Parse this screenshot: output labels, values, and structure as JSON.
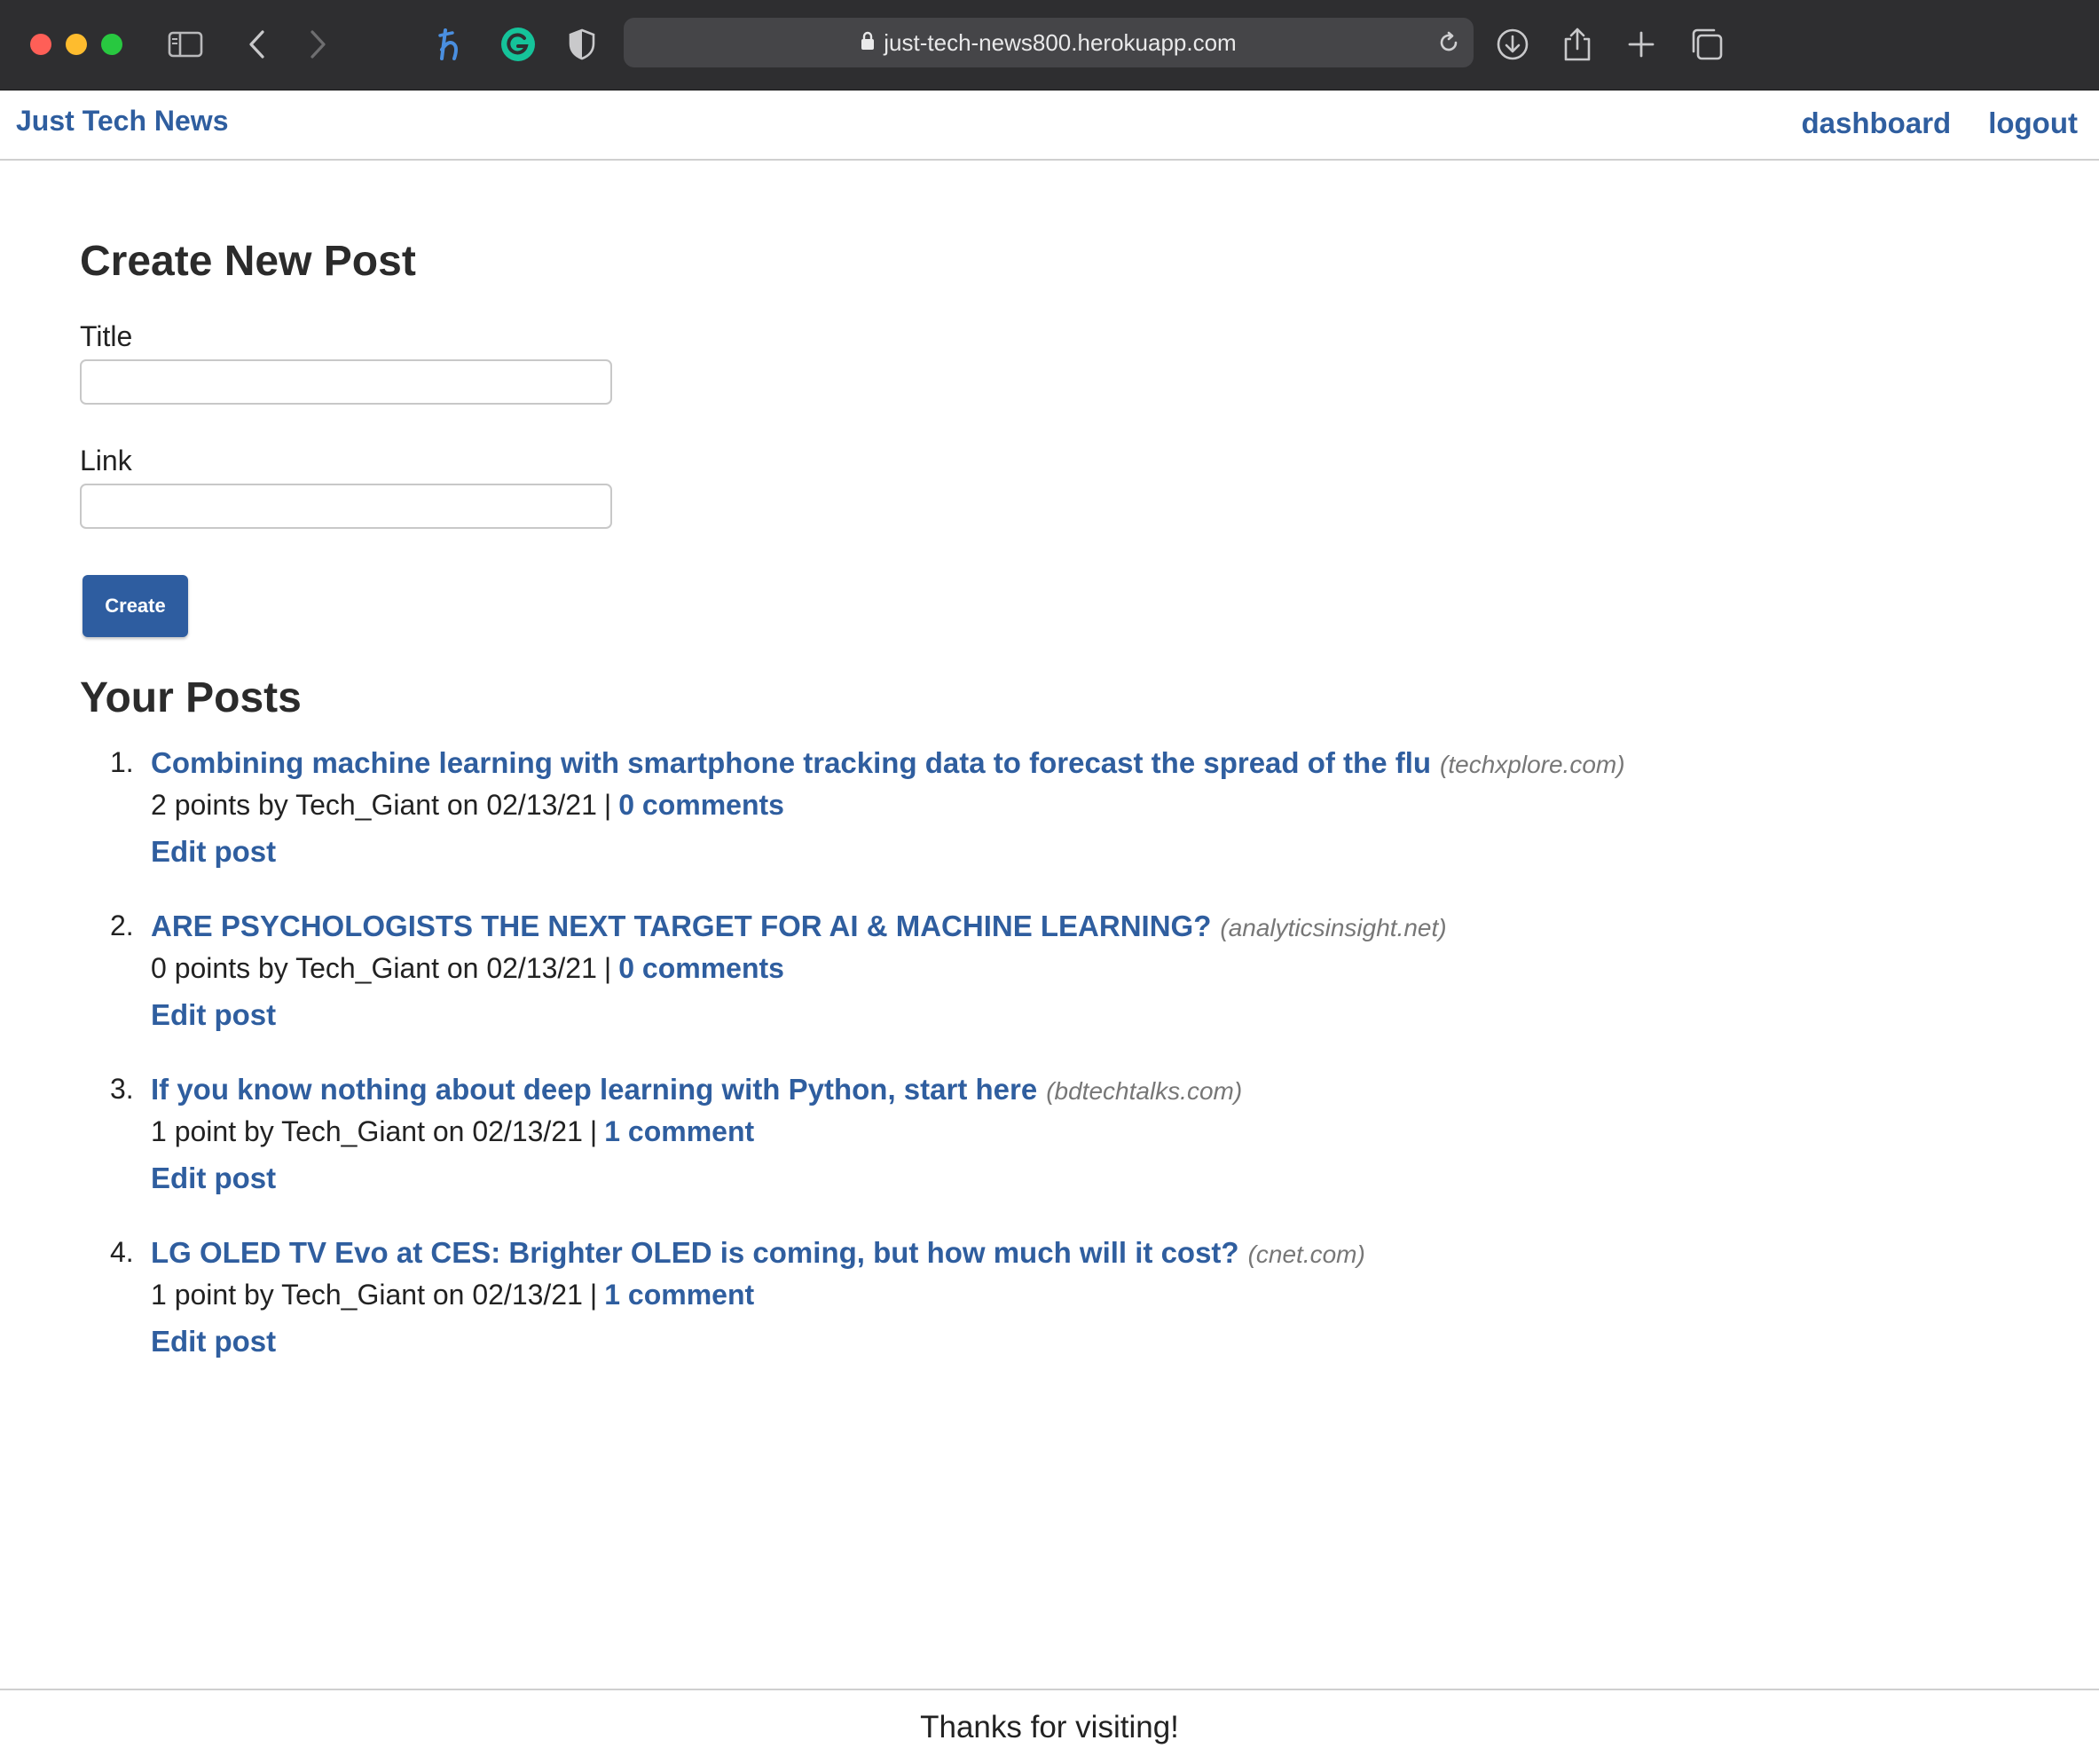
{
  "browser": {
    "url": "just-tech-news800.herokuapp.com"
  },
  "header": {
    "brand": "Just Tech News",
    "nav": [
      "dashboard",
      "logout"
    ]
  },
  "create": {
    "heading": "Create New Post",
    "title_label": "Title",
    "title_value": "",
    "link_label": "Link",
    "link_value": "",
    "button": "Create"
  },
  "posts_section": {
    "heading": "Your Posts",
    "posts": [
      {
        "num": "1.",
        "title": "Combining machine learning with smartphone tracking data to forecast the spread of the flu",
        "domain": "(techxplore.com)",
        "meta": "2 points by Tech_Giant on 02/13/21",
        "comments": "0 comments",
        "edit": "Edit post"
      },
      {
        "num": "2.",
        "title": "ARE PSYCHOLOGISTS THE NEXT TARGET FOR AI & MACHINE LEARNING?",
        "domain": "(analyticsinsight.net)",
        "meta": "0 points by Tech_Giant on 02/13/21",
        "comments": "0 comments",
        "edit": "Edit post"
      },
      {
        "num": "3.",
        "title": "If you know nothing about deep learning with Python, start here",
        "domain": "(bdtechtalks.com)",
        "meta": "1 point by Tech_Giant on 02/13/21",
        "comments": "1 comment",
        "edit": "Edit post"
      },
      {
        "num": "4.",
        "title": "LG OLED TV Evo at CES: Brighter OLED is coming, but how much will it cost?",
        "domain": "(cnet.com)",
        "meta": "1 point by Tech_Giant on 02/13/21",
        "comments": "1 comment",
        "edit": "Edit post"
      }
    ]
  },
  "footer": {
    "text": "Thanks for visiting!"
  },
  "colors": {
    "link": "#2f5e9f",
    "button": "#2e5da0",
    "chrome": "#2e2e30"
  }
}
